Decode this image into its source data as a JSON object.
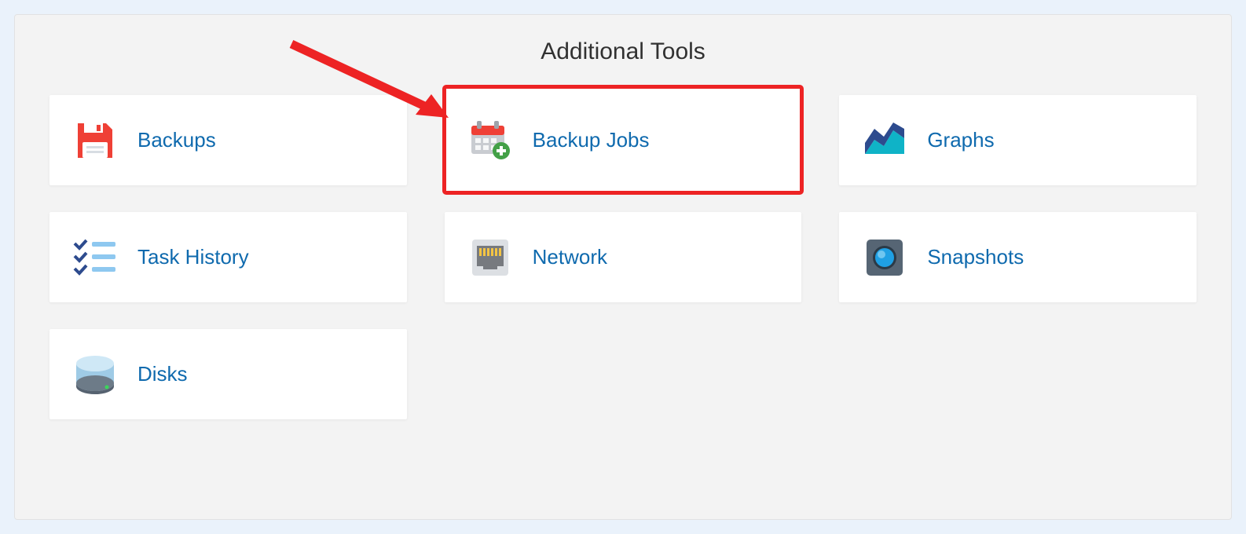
{
  "section": {
    "title": "Additional Tools"
  },
  "tools": {
    "backups": {
      "label": "Backups",
      "icon": "floppy-disk-icon"
    },
    "backup_jobs": {
      "label": "Backup Jobs",
      "icon": "calendar-add-icon",
      "highlighted": true
    },
    "graphs": {
      "label": "Graphs",
      "icon": "area-chart-icon"
    },
    "task_history": {
      "label": "Task History",
      "icon": "checklist-icon"
    },
    "network": {
      "label": "Network",
      "icon": "ethernet-port-icon"
    },
    "snapshots": {
      "label": "Snapshots",
      "icon": "camera-lens-icon"
    },
    "disks": {
      "label": "Disks",
      "icon": "hard-drive-icon"
    }
  },
  "annotation": {
    "type": "arrow",
    "color": "#ed2324",
    "target": "backup_jobs"
  }
}
